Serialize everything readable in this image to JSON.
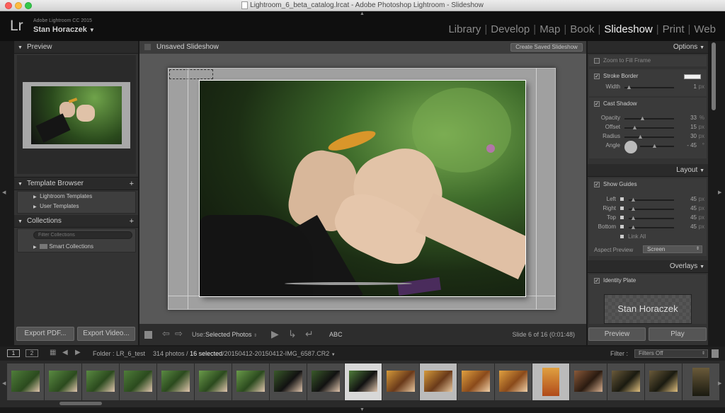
{
  "window": {
    "title": "Lightroom_6_beta_catalog.lrcat - Adobe Photoshop Lightroom - Slideshow"
  },
  "identity": {
    "logo": "Lr",
    "app": "Adobe Lightroom CC 2015",
    "user": "Stan Horaczek"
  },
  "modules": [
    "Library",
    "Develop",
    "Map",
    "Book",
    "Slideshow",
    "Print",
    "Web"
  ],
  "active_module": "Slideshow",
  "left": {
    "preview_title": "Preview",
    "template_title": "Template Browser",
    "templates": [
      "Lightroom Templates",
      "User Templates"
    ],
    "collections_title": "Collections",
    "filter_placeholder": "Filter Collections",
    "smart": "Smart Collections",
    "export_pdf": "Export PDF...",
    "export_video": "Export Video..."
  },
  "center": {
    "title": "Unsaved Slideshow",
    "create_btn": "Create Saved Slideshow",
    "use_label": "Use:",
    "use_value": "Selected Photos",
    "abc": "ABC",
    "slide_info": "Slide 6 of 16 (0:01:48)"
  },
  "right": {
    "options_title": "Options",
    "zoom": "Zoom to Fill Frame",
    "stroke": "Stroke Border",
    "width_label": "Width",
    "width_val": "1",
    "px": "px",
    "pct": "%",
    "deg": "°",
    "shadow": "Cast Shadow",
    "opacity_label": "Opacity",
    "opacity_val": "33",
    "offset_label": "Offset",
    "offset_val": "15",
    "radius_label": "Radius",
    "radius_val": "30",
    "angle_label": "Angle",
    "angle_val": "- 45",
    "layout_title": "Layout",
    "show_guides": "Show Guides",
    "left_label": "Left",
    "left_val": "45",
    "right_label": "Right",
    "right_val": "45",
    "top_label": "Top",
    "top_val": "45",
    "bottom_label": "Bottom",
    "bottom_val": "45",
    "link_all": "Link All",
    "aspect_label": "Aspect Preview",
    "aspect_value": "Screen",
    "overlays_title": "Overlays",
    "identity_plate": "Identity Plate",
    "plate_text": "Stan Horaczek",
    "preview_btn": "Preview",
    "play_btn": "Play"
  },
  "filmbar": {
    "page1": "1",
    "page2": "2",
    "folder": "Folder : LR_6_test",
    "count_pre": "314 photos /",
    "count_sel": "16 selected",
    "count_post": "/20150412-20150412-IMG_6587.CR2",
    "filter_label": "Filter :",
    "filter_value": "Filters Off"
  }
}
